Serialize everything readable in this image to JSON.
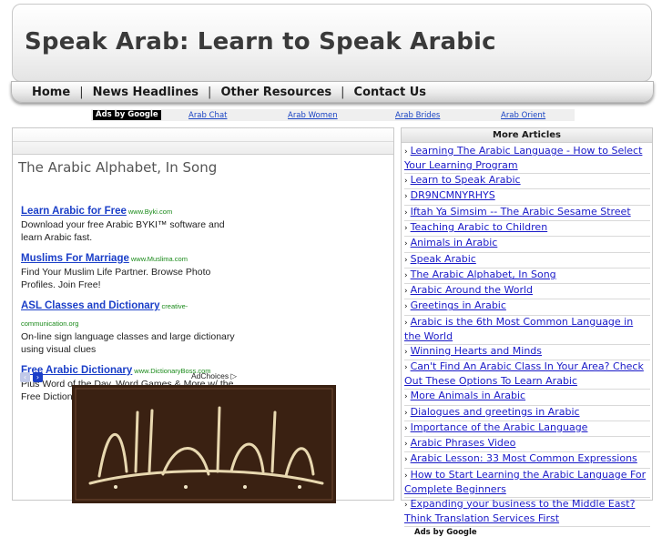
{
  "site": {
    "title": "Speak Arab: Learn to Speak Arabic"
  },
  "nav": {
    "items": [
      {
        "label": "Home"
      },
      {
        "label": "News Headlines"
      },
      {
        "label": "Other Resources"
      },
      {
        "label": "Contact Us"
      }
    ],
    "separator": "|"
  },
  "ad_bar": {
    "label": "Ads by Google",
    "links": [
      "Arab Chat",
      "Arab Women",
      "Arab Brides",
      "Arab Orient"
    ]
  },
  "main": {
    "title": "The Arabic Alphabet, In Song",
    "ads": [
      {
        "title": "Learn Arabic for Free",
        "url": "www.Byki.com",
        "desc": "Download your free Arabic BYKI™ software and learn Arabic fast."
      },
      {
        "title": "Muslims For Marriage",
        "url": "www.Muslima.com",
        "desc": "Find Your Muslim Life Partner. Browse Photo Profiles. Join Free!"
      },
      {
        "title": "ASL Classes and Dictionary",
        "url": "creative-communication.org",
        "desc": "On-line sign language classes and large dictionary using visual clues"
      },
      {
        "title": "Free Arabic Dictionary",
        "url": "www.DictionaryBoss.com",
        "desc": "Plus Word of the Day, Word Games & More w/ the Free Dictionary Toolbar"
      }
    ],
    "adchoices": "AdChoices"
  },
  "sidebar": {
    "title": "More Articles",
    "articles": [
      "Learning The Arabic Language - How to Select Your Learning Program",
      "Learn to Speak Arabic",
      "DR9NCMNYRHYS",
      "Iftah Ya Simsim -- The Arabic Sesame Street",
      "Teaching Arabic to Children",
      "Animals in Arabic",
      "Speak Arabic",
      "The Arabic Alphabet, In Song",
      "Arabic Around the World",
      "Greetings in Arabic",
      "Arabic is the 6th Most Common Language in the World",
      "Winning Hearts and Minds",
      "Can't Find An Arabic Class In Your Area? Check Out These Options To Learn Arabic",
      "More Animals in Arabic",
      "Dialogues and greetings in Arabic",
      "Importance of the Arabic Language",
      "Arabic Phrases Video",
      "Arabic Lesson: 33 Most Common Expressions",
      "How to Start Learning the Arabic Language For Complete Beginners",
      "Expanding your business to the Middle East? Think Translation Services First"
    ],
    "ads_label": "Ads by Google"
  },
  "icons": {
    "arrow": "›",
    "prev": "‹",
    "next": "›",
    "adchoices": "▷"
  },
  "colors": {
    "link": "#1a1ac8",
    "ad_title": "#1a3ec8",
    "ad_url": "#1a8a1a"
  }
}
